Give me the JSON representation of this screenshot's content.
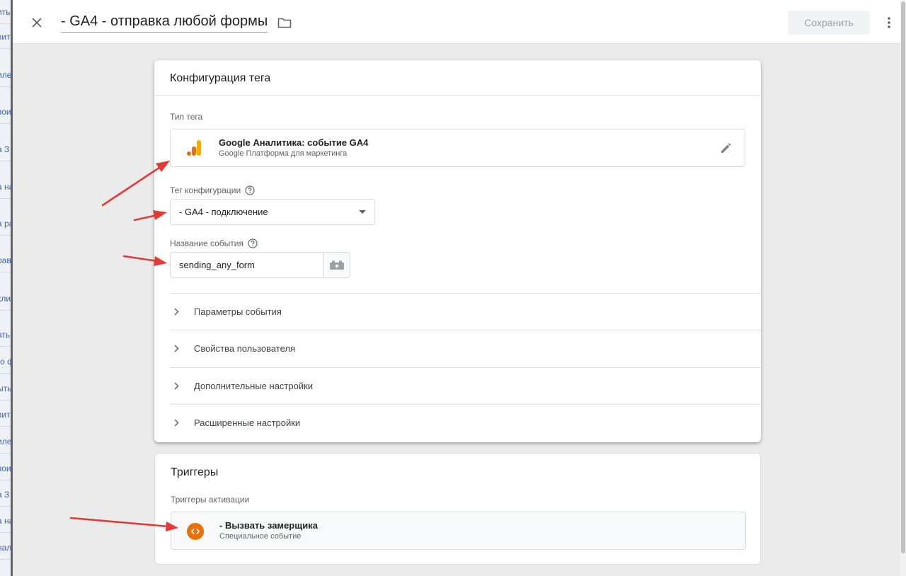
{
  "background_fragments": [
    "ить",
    "вит",
    "иле",
    "вои",
    "а З",
    "а на",
    "а ра",
    "рав",
    "кли",
    "ать",
    "го ф",
    "ыть",
    "вит",
    "иле",
    "вои",
    "а З",
    "а на",
    "нал"
  ],
  "header": {
    "title": "- GA4 - отправка любой формы",
    "save_label": "Сохранить"
  },
  "config": {
    "heading": "Конфигурация тега",
    "tag_type_label": "Тип тега",
    "tag_type_name": "Google Аналитика: событие GA4",
    "tag_type_sub": "Google Платформа для маркетинга",
    "config_tag_label": "Тег конфигурации",
    "config_tag_value": "- GA4 - подключение",
    "event_name_label": "Название события",
    "event_name_value": "sending_any_form",
    "sections": [
      "Параметры события",
      "Свойства пользователя",
      "Дополнительные настройки",
      "Расширенные настройки"
    ]
  },
  "triggers": {
    "heading": "Триггеры",
    "activation_label": "Триггеры активации",
    "item_name": "- Вызвать замерщика",
    "item_sub": "Специальное событие"
  },
  "colors": {
    "annotation_arrow": "#e53935",
    "ga_orange": "#f9ab00",
    "ga_dark_orange": "#e37400",
    "trigger_icon": "#e8710a"
  }
}
